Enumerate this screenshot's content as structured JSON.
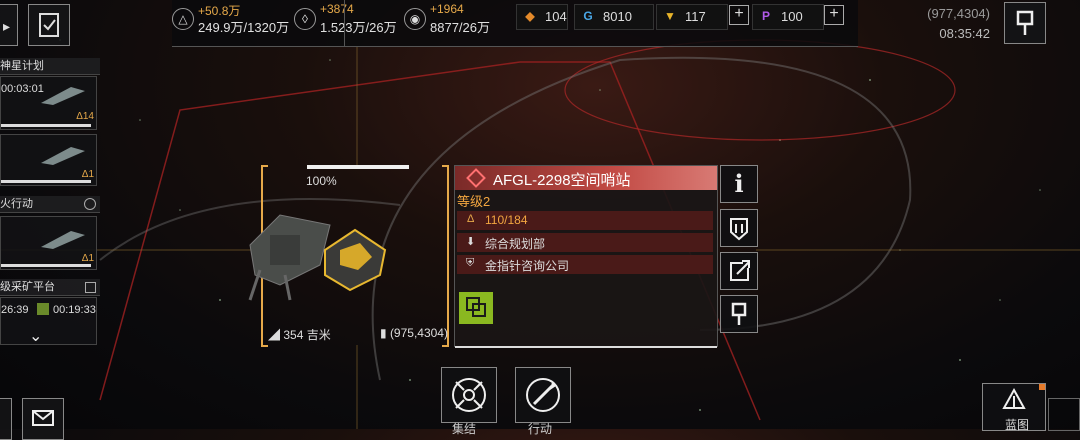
{
  "resources": [
    {
      "icon": "tritanium-icon",
      "symbol": "△",
      "delta": "+50.8万",
      "value": "249.9万/1320万"
    },
    {
      "icon": "crystal-icon",
      "symbol": "◊",
      "delta": "+3874",
      "value": "1.523万/26万"
    },
    {
      "icon": "heavy-water-icon",
      "symbol": "◉",
      "delta": "+1964",
      "value": "8877/26万"
    }
  ],
  "currencies": [
    {
      "icon": "orange-currency-icon",
      "value": "104",
      "color": "#e48a2a"
    },
    {
      "icon": "blue-currency-icon",
      "value": "8010",
      "color": "#4aa8e8"
    },
    {
      "icon": "gold-currency-icon",
      "value": "117",
      "color": "#e8b42a"
    },
    {
      "icon": "purple-currency-icon",
      "value": "100",
      "color": "#b25ae8"
    }
  ],
  "header": {
    "coordinates": "(977,4304)",
    "time": "08:35:42"
  },
  "left_panel": {
    "fleet1_title": "神星计划",
    "fleet1_timer": "00:03:01",
    "fleet1_badge": "14",
    "fleet2_badge": "1",
    "fleet3_title": "火行动",
    "fleet3_badge": "1",
    "mining_title": "级采矿平台",
    "mining_timer1": "26:39",
    "mining_timer2": "00:19:33"
  },
  "target": {
    "health_percent": "100%",
    "health_fraction": 1.0,
    "distance": "354 吉米",
    "location": "(975,4304)"
  },
  "info_panel": {
    "title": "AFGL-2298空间哨站",
    "level": "等级2",
    "hp": "110/184",
    "department": "综合规划部",
    "company": "金指针咨询公司"
  },
  "bottom_buttons": {
    "attack_label": "集结",
    "lock_label": "行动"
  },
  "blueprint_label": "蓝图",
  "colors": {
    "accent_orange": "#e6a94a",
    "panel_red": "#c24a44",
    "dark_red_row": "#4a1a18",
    "green_button": "#8ab820"
  }
}
